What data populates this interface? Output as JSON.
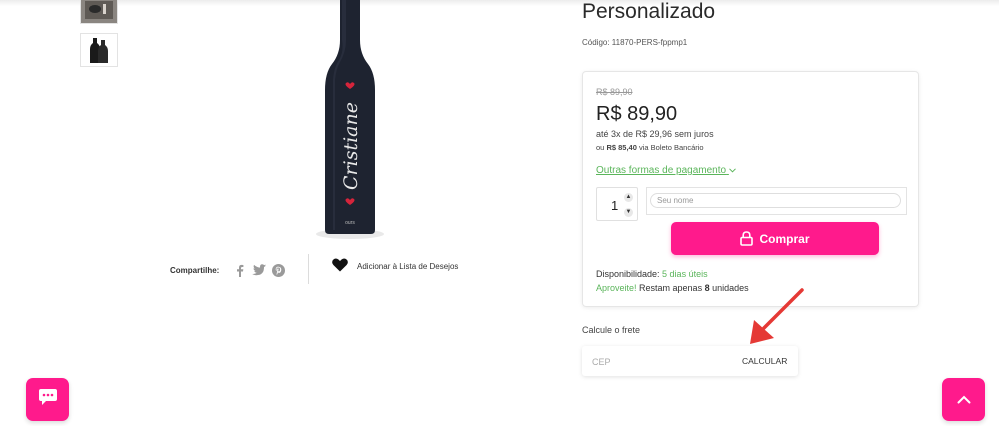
{
  "product": {
    "title": "Personalizado",
    "code": "Código: 11870-PERS-fppmp1",
    "bottle_text": "Cristiane",
    "bottle_brand": "ours"
  },
  "share": {
    "label": "Compartilhe:",
    "icons": [
      "facebook-icon",
      "twitter-icon",
      "pinterest-icon"
    ]
  },
  "wishlist": {
    "label": "Adicionar à Lista de Desejos"
  },
  "pricing": {
    "old_price": "R$ 89,90",
    "price": "R$ 89,90",
    "installments": "até 3x de R$ 29,96 sem juros",
    "boleto_prefix": "ou ",
    "boleto_amount": "R$ 85,40",
    "boleto_suffix": " via Boleto Bancário",
    "payment_link": "Outras formas de pagamento"
  },
  "purchase": {
    "quantity": "1",
    "name_placeholder": "Seu nome",
    "buy_label": "Comprar"
  },
  "availability": {
    "label": "Disponibilidade: ",
    "value": "5 dias úteis",
    "stock_highlight": "Aproveite!",
    "stock_text_before": " Restam apenas ",
    "stock_count": "8",
    "stock_text_after": " unidades"
  },
  "freight": {
    "label": "Calcule o frete",
    "cep_placeholder": "CEP",
    "calc_label": "CALCULAR"
  },
  "colors": {
    "accent": "#ff1a8c",
    "green": "#5ab55a",
    "arrow": "#e53935"
  }
}
